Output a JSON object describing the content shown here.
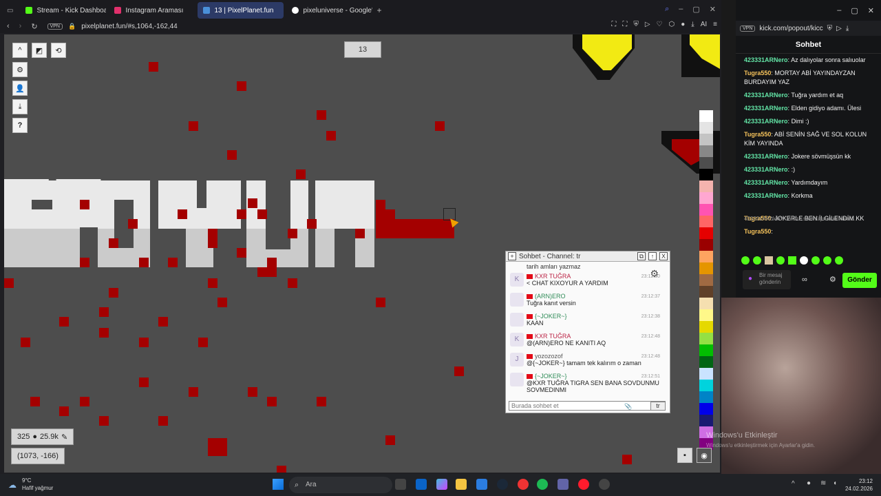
{
  "browser": {
    "tabs": [
      {
        "label": "Stream - Kick Dashboard",
        "color": "#53fc18"
      },
      {
        "label": "Instagram Araması",
        "color": "#e1306c"
      },
      {
        "label": "13 | PixelPlanet.fun",
        "color": "#4a90d9"
      },
      {
        "label": "pixeluniverse - Google'da",
        "color": "#ffffff"
      }
    ],
    "url": "pixelplanet.fun/#s,1064,-162,44",
    "vpn": "VPN",
    "ai": "AI"
  },
  "canvas": {
    "online_count": "13",
    "users_stat": "325",
    "pixels_stat": "25.9k",
    "coords": "(1073, -166)"
  },
  "palette": [
    "#ffffff",
    "#e4e4e4",
    "#c4c4c4",
    "#888888",
    "#4e4e4e",
    "#000000",
    "#f4b3ae",
    "#ffa7d1",
    "#ff54b2",
    "#ff6565",
    "#e50000",
    "#9a0000",
    "#fea460",
    "#e59500",
    "#a06a42",
    "#604028",
    "#f5dfb0",
    "#fff889",
    "#e5d900",
    "#94e044",
    "#02be01",
    "#006513",
    "#cae3ff",
    "#00d3dd",
    "#0083c7",
    "#0000ea",
    "#191973",
    "#cf6ee4",
    "#820080"
  ],
  "chat": {
    "title": "Sohbet - Channel: tr",
    "first_line": "tarih amları yazmaz",
    "messages": [
      {
        "avatar": "K",
        "name": "KXR TUĞRA",
        "text": "< CHAT KIXOYUR A YARDIM",
        "time": "23:12:30",
        "color": "red"
      },
      {
        "avatar": "",
        "name": "(ARN)ERO",
        "text": "Tuğra kanıt versin",
        "time": "23:12:37",
        "color": "green"
      },
      {
        "avatar": "",
        "name": "{~JOKER~}",
        "text": "KAAN",
        "time": "23:12:38",
        "color": "green"
      },
      {
        "avatar": "K",
        "name": "KXR TUĞRA",
        "text": "@(ARN)ERO NE KANITI AQ",
        "time": "23:12:48",
        "color": "red"
      },
      {
        "avatar": "J",
        "name": "yozozozof",
        "text": "@{~JOKER~} tamam tek kalırım o zaman",
        "time": "23:12:48",
        "color": "dark"
      },
      {
        "avatar": "",
        "name": "{~JOKER~}",
        "text": "@KXR TUĞRA TIGRA SEN BANA SOVDUNMU SOVMEDINMI",
        "time": "23:12:51",
        "color": "green"
      }
    ],
    "input_placeholder": "Burada sohbet et",
    "lang": "tr"
  },
  "kick": {
    "url": "kick.com/popout/kicc",
    "header": "Sohbet",
    "messages": [
      {
        "user": "423331ARNero",
        "text": "Az dalıyolar sonra salıuolar",
        "type": "g"
      },
      {
        "user": "Tugra550",
        "text": "MORTAY ABİ YAYINDAYZAN BURDAYIM YAZ",
        "type": "o"
      },
      {
        "user": "423331ARNero",
        "text": "Tuğra yardım et aq",
        "type": "g"
      },
      {
        "user": "423331ARNero",
        "text": "Elden gidiyo adamı. Ülesi",
        "type": "g"
      },
      {
        "user": "423331ARNero",
        "text": "Dimi :)",
        "type": "g"
      },
      {
        "user": "Tugra550",
        "text": "ABİ SENİN SAĞ VE SOL KOLUN KİM YAYINDA",
        "type": "o"
      },
      {
        "user": "423331ARNero",
        "text": "Jokere sövmüşsün kk",
        "type": "g"
      },
      {
        "user": "423331ARNero",
        "text": ":)",
        "type": "g"
      },
      {
        "user": "423331ARNero",
        "text": "Yardımdayım",
        "type": "g"
      },
      {
        "user": "423331ARNero",
        "text": "Korkma",
        "type": "g"
      },
      {
        "user": "Tugra550",
        "text": "JOKERLE BEN İLGİLENDİM KK",
        "type": "o"
      },
      {
        "user": "Tugra550",
        "text": "",
        "type": "o"
      }
    ],
    "reply_hint": "423331ARNero: Jokere sövmüşsün kk isimli...",
    "input_placeholder": "Bir mesaj gönderin",
    "send": "Gönder"
  },
  "windows": {
    "activate": "Windows'u Etkinleştir",
    "activate_sub": "Windows'u etkinleştirmek için Ayarlar'a gidin.",
    "weather_temp": "9°C",
    "weather_desc": "Hafif yağmur",
    "search": "Ara",
    "time": "23:12",
    "date": "24.02.2026"
  }
}
